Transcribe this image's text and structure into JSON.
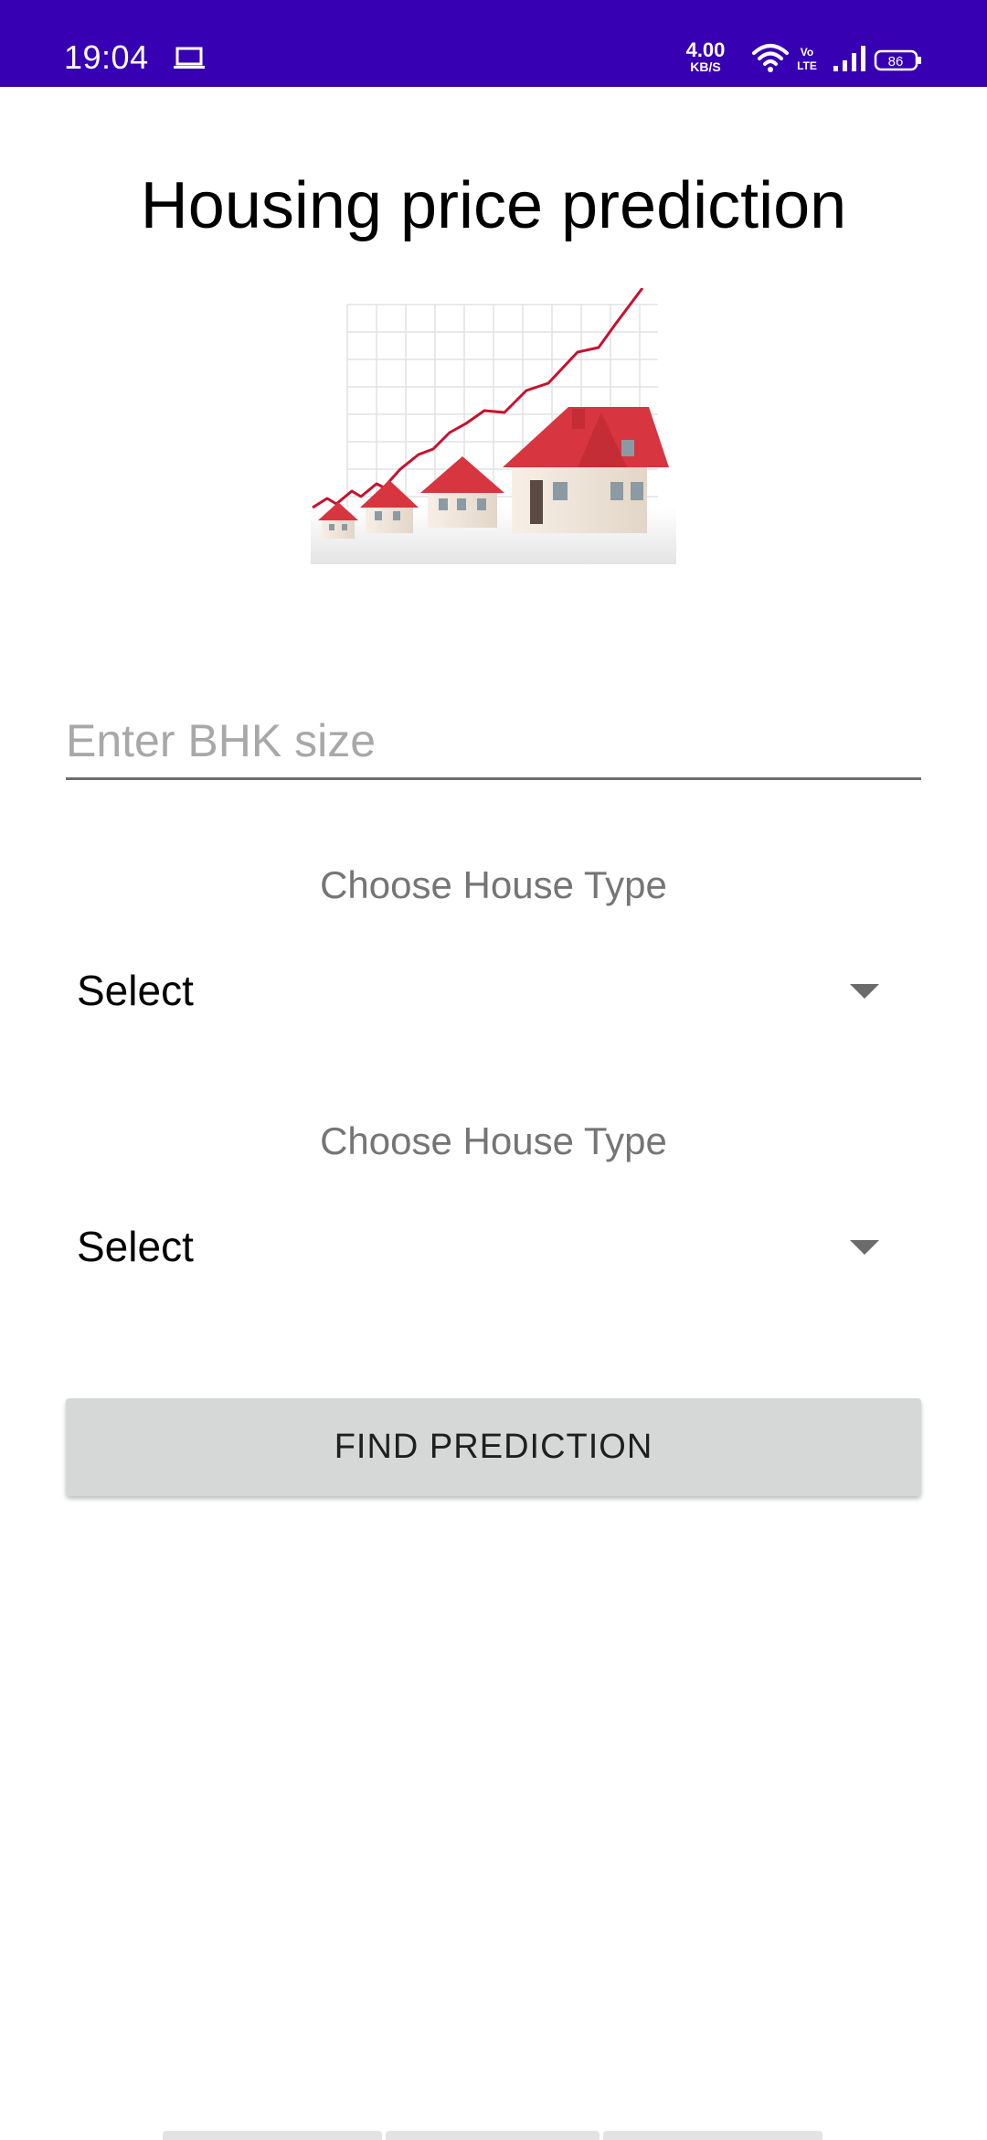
{
  "status_bar": {
    "time": "19:04",
    "net_speed_value": "4.00",
    "net_speed_unit": "KB/S",
    "volte_label": "Vo LTE",
    "battery": "86",
    "background_color": "#3700b3"
  },
  "app": {
    "title": "Housing price prediction",
    "bhk_input": {
      "placeholder": "Enter BHK size",
      "value": ""
    },
    "house_type_1": {
      "label": "Choose House Type",
      "selected": "Select"
    },
    "house_type_2": {
      "label": "Choose House Type",
      "selected": "Select"
    },
    "find_button": {
      "label": "FIND PREDICTION"
    }
  },
  "colors": {
    "accent": "#3700b3",
    "button_bg": "#d6d7d7",
    "label_gray": "#757575",
    "chart_line": "#c8102e",
    "roof_red": "#d7353f"
  }
}
